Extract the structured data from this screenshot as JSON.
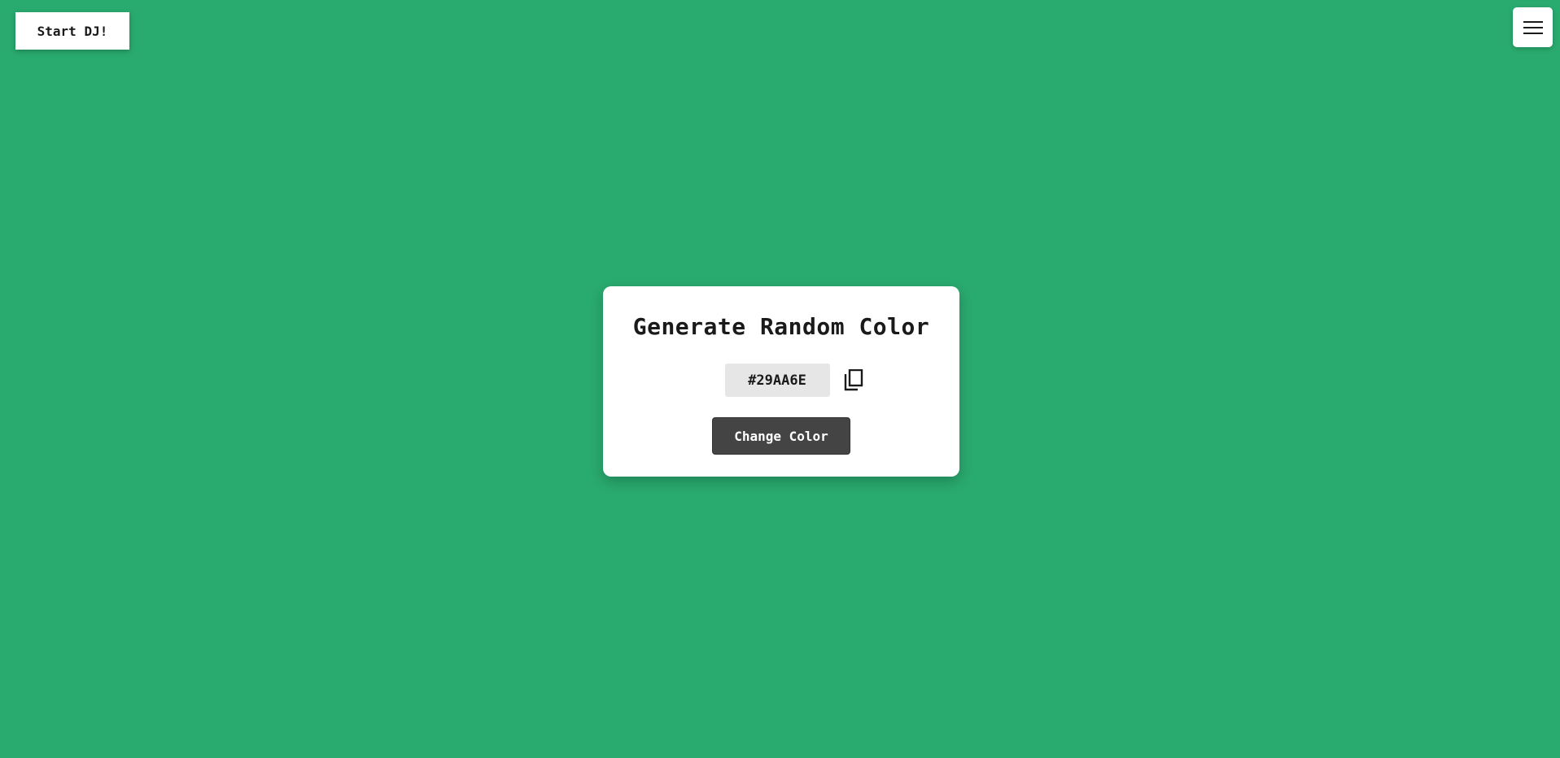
{
  "page": {
    "background_color": "#29AA6E"
  },
  "dj_button": {
    "label": "Start DJ!"
  },
  "menu_button": {
    "icon": "hamburger-menu-icon"
  },
  "card": {
    "title": "Generate Random Color",
    "hex_value": "#29AA6E",
    "copy_icon": "copy-icon",
    "change_button_label": "Change Color"
  },
  "colors": {
    "card_background": "#ffffff",
    "hex_background": "#e6e6e6",
    "button_background": "#444444",
    "text_dark": "#1a1a1a"
  }
}
